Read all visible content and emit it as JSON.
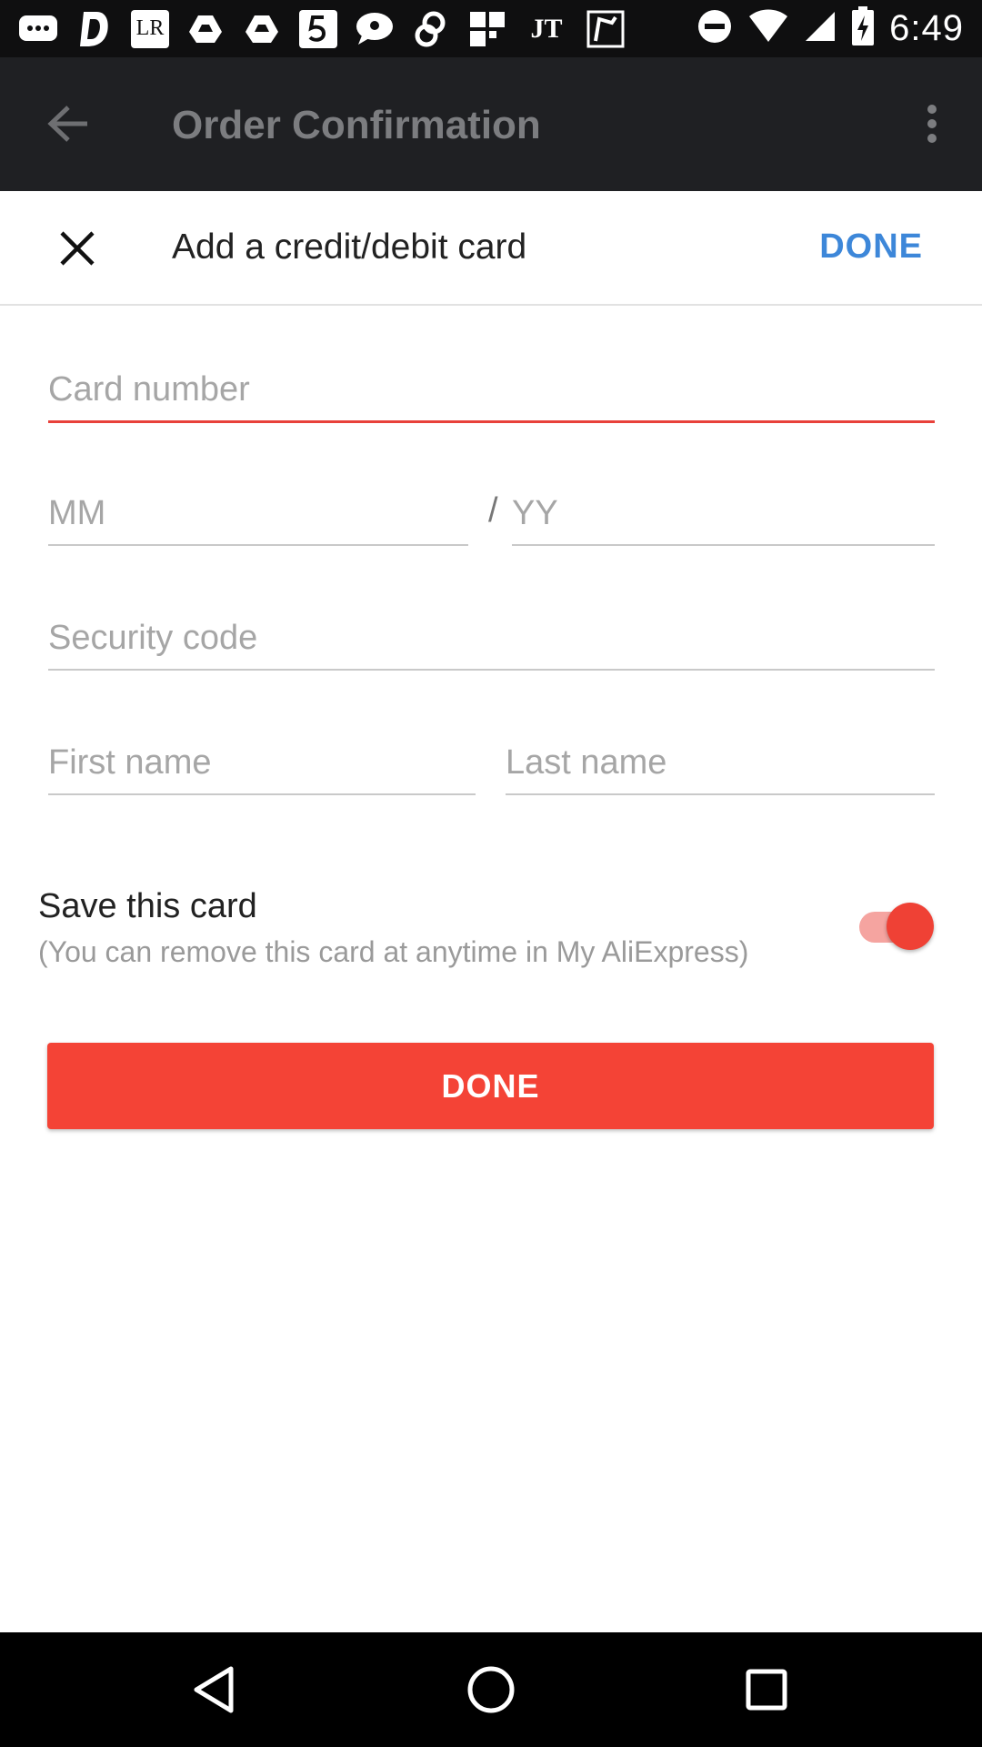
{
  "status_bar": {
    "time": "6:49",
    "icons": [
      "messages-icon",
      "d-app-icon",
      "lr-app-icon",
      "drive-icon",
      "drive-icon",
      "five-app-icon",
      "chat-icon",
      "link-app-icon",
      "grid-app-icon",
      "jt-app-icon",
      "map-app-icon",
      "do-not-disturb-icon",
      "wifi-icon",
      "signal-icon",
      "battery-charging-icon"
    ],
    "lr_label": "LR",
    "jt_label": "JT"
  },
  "app_bar": {
    "title": "Order Confirmation"
  },
  "dialog": {
    "title": "Add a credit/debit card",
    "done_label": "DONE"
  },
  "form": {
    "card_number": {
      "value": "",
      "placeholder": "Card number"
    },
    "month": {
      "value": "",
      "placeholder": "MM"
    },
    "separator": "/",
    "year": {
      "value": "",
      "placeholder": "YY"
    },
    "security_code": {
      "value": "",
      "placeholder": "Security code"
    },
    "first_name": {
      "value": "",
      "placeholder": "First name"
    },
    "last_name": {
      "value": "",
      "placeholder": "Last name"
    }
  },
  "save_card": {
    "title": "Save this card",
    "subtitle": "(You can remove this card at anytime in My AliExpress)",
    "enabled": true
  },
  "done_button": {
    "label": "DONE"
  },
  "colors": {
    "accent_red": "#f44336",
    "link_blue": "#3d87d9",
    "app_bar": "#1f2023"
  }
}
